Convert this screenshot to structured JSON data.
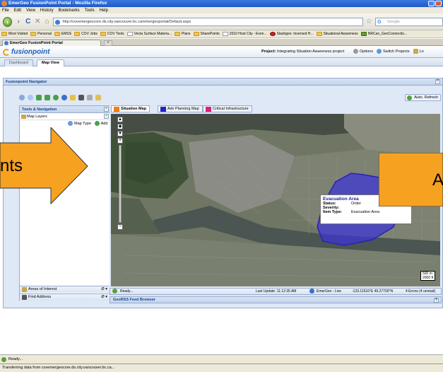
{
  "window": {
    "title": "EmerGeo FusionPoint Portal - Mozilla Firefox"
  },
  "menu": [
    "File",
    "Edit",
    "View",
    "History",
    "Bookmarks",
    "Tools",
    "Help"
  ],
  "nav": {
    "url": "http://covemergeocore.ds.city.vancouver.bc.ca/emergeoportal/Default.aspx",
    "search_placeholder": "Google"
  },
  "bookmarks": [
    "Most Visited",
    "Personal",
    "EMSS",
    "COV Jobs",
    "COV Tools",
    "Vecta Surface Materia...",
    "Plans",
    "SharePoints",
    "2010 Host City - Even...",
    "Slashgeo: Inversed H...",
    "Situational Awareness",
    "NRCan_GeoConnectio..."
  ],
  "browser_tab": {
    "label": "EmerGeo FusionPoint Portal"
  },
  "app": {
    "logo": "fusionpoint",
    "project_label": "Project:",
    "project_name": "Integrating Situation Awareness project",
    "options": "Options",
    "switch_projects": "Switch Projects",
    "more": "Lo"
  },
  "app_tabs": [
    "Dashboard",
    "Map View"
  ],
  "navigator": {
    "title": "Fusionpoint Navigator",
    "auto_refresh": "Auto. Refresh"
  },
  "left_panel": {
    "title": "Tools & Navigation",
    "map_layers": "Map Layers",
    "map_type": "Map Type",
    "add": "Add",
    "areas_of_interest": "Areas of Interest",
    "find_address": "Find Address",
    "section_controls": "Ø ▾"
  },
  "map_tabs": [
    {
      "label": "Situation Map",
      "color": "#f08010"
    },
    {
      "label": "Adv Planning Map",
      "color": "#2323c8"
    },
    {
      "label": "Critical Infrastructure",
      "color": "#e0207a"
    }
  ],
  "popup": {
    "title": "Evacuation Area",
    "fields": [
      {
        "k": "Status:",
        "v": "Order"
      },
      {
        "k": "Severity:",
        "v": ""
      },
      {
        "k": "Item Type:",
        "v": "Evacuation Area"
      }
    ]
  },
  "scale": {
    "m": "500 m",
    "ft": "2000 ft"
  },
  "map_status": {
    "ready": "Ready...",
    "last_update": "Last Update: 11:12:35 AM",
    "feed": "EmerGeo - Live",
    "coords": "-123.11516°E 49.27700°N",
    "errors": "4 Errors (4 unread)"
  },
  "georss": "GeoRSS Feed Browser",
  "overlay": {
    "left_text": "nts",
    "right_text": "A"
  },
  "status": {
    "ready": "Ready...",
    "transfer": "Transferring data from covemergeocore.ds.city.vancouver.bc.ca..."
  }
}
